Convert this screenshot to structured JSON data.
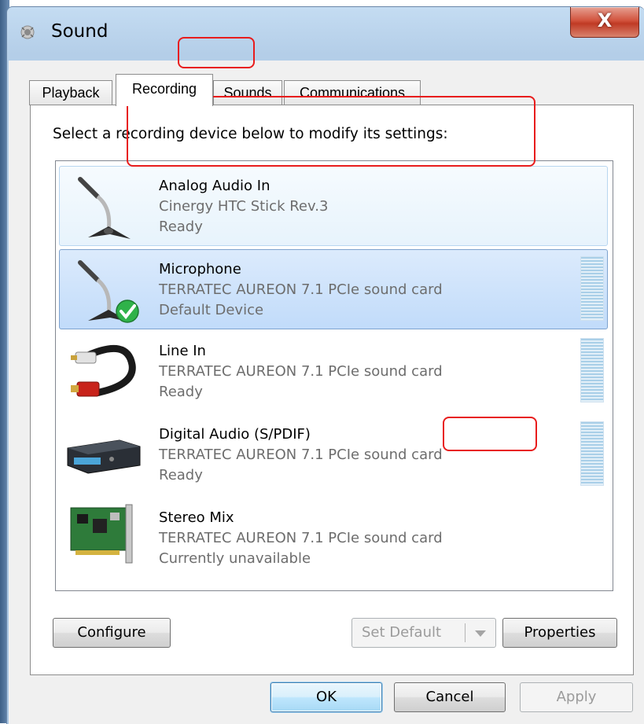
{
  "window": {
    "title": "Sound",
    "close_label": "X"
  },
  "tabs": [
    {
      "label": "Playback",
      "active": false
    },
    {
      "label": "Recording",
      "active": true
    },
    {
      "label": "Sounds",
      "active": false
    },
    {
      "label": "Communications",
      "active": false
    }
  ],
  "recording": {
    "instructions": "Select a recording device below to modify its settings:",
    "devices": [
      {
        "name": "Analog Audio In",
        "driver": "Cinergy HTC Stick Rev.3",
        "status": "Ready",
        "icon": "microphone-icon",
        "meter": false,
        "state": "hover"
      },
      {
        "name": "Microphone",
        "driver": "TERRATEC AUREON 7.1 PCIe sound card",
        "status": "Default Device",
        "icon": "microphone-default-icon",
        "meter": true,
        "state": "selected"
      },
      {
        "name": "Line In",
        "driver": "TERRATEC AUREON 7.1 PCIe sound card",
        "status": "Ready",
        "icon": "rca-cable-icon",
        "meter": true,
        "state": "normal"
      },
      {
        "name": "Digital Audio (S/PDIF)",
        "driver": "TERRATEC AUREON 7.1 PCIe sound card",
        "status": "Ready",
        "icon": "spdif-device-icon",
        "meter": true,
        "state": "normal"
      },
      {
        "name": "Stereo Mix",
        "driver": "TERRATEC AUREON 7.1 PCIe sound card",
        "status": "Currently unavailable",
        "icon": "sound-card-icon",
        "meter": false,
        "state": "normal"
      }
    ],
    "buttons": {
      "configure": "Configure",
      "set_default": "Set Default",
      "properties": "Properties"
    }
  },
  "dialog_buttons": {
    "ok": "OK",
    "cancel": "Cancel",
    "apply": "Apply"
  },
  "colors": {
    "annotation": "#e81c1c",
    "selection": "#c1dbfa",
    "default_check": "#2fb24a"
  }
}
